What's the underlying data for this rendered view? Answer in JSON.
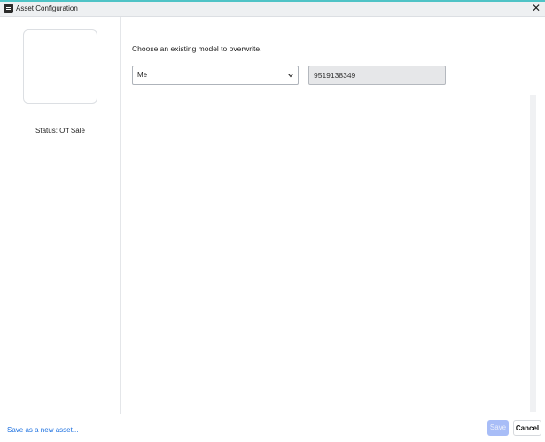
{
  "window": {
    "title": "Asset Configuration",
    "app_icon": "roblox-studio-icon",
    "close_icon": "close-icon"
  },
  "sidebar": {
    "status": "Status: Off Sale"
  },
  "main": {
    "instruction": "Choose an existing model to overwrite.",
    "model_select": {
      "selected": "Me",
      "icon": "chevron-down-icon"
    },
    "asset_id": "9519138349"
  },
  "footer": {
    "save_new_label": "Save as a new asset...",
    "save_label": "Save",
    "cancel_label": "Cancel"
  },
  "colors": {
    "accent_top": "#4fc3c6",
    "link": "#1a6fe0",
    "save_disabled": "#a8bdf7",
    "field_disabled_bg": "#e6e7e9"
  }
}
